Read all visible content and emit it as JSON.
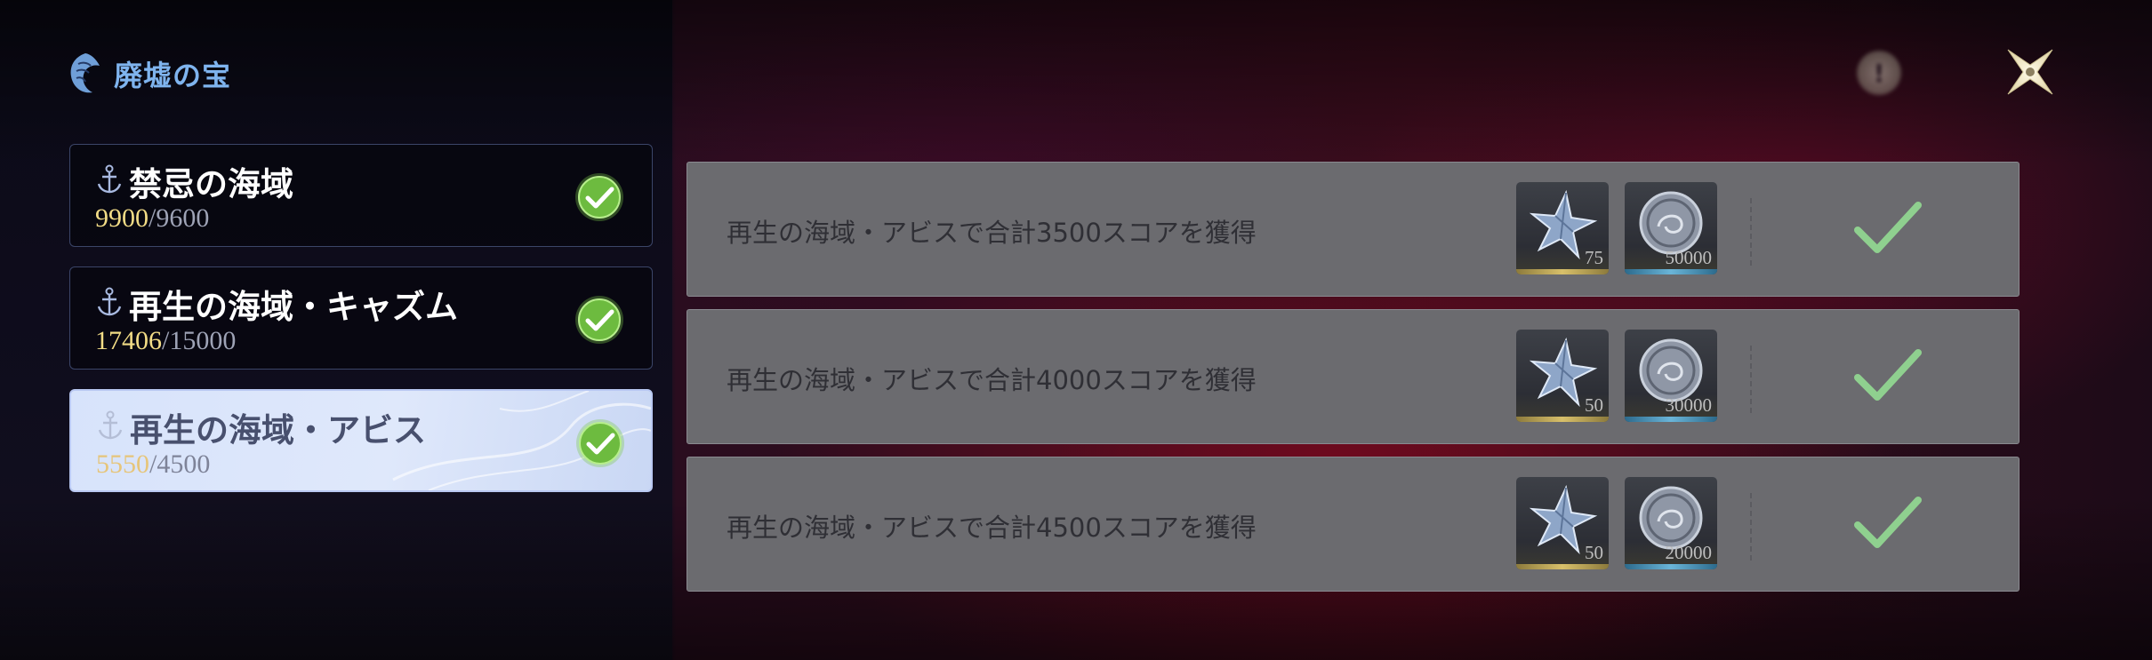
{
  "header": {
    "title": "廃墟の宝",
    "close_icon": "close-x-icon",
    "info_icon": "info-icon"
  },
  "sidebar": {
    "items": [
      {
        "name": "禁忌の海域",
        "current": "9900",
        "separator": "/",
        "max": "9600",
        "completed": true,
        "active": false
      },
      {
        "name": "再生の海域・キャズム",
        "current": "17406",
        "separator": "/",
        "max": "15000",
        "completed": true,
        "active": false
      },
      {
        "name": "再生の海域・アビス",
        "current": "5550",
        "separator": "/",
        "max": "4500",
        "completed": true,
        "active": true
      }
    ]
  },
  "tasks": [
    {
      "description": "再生の海域・アビスで合計3500スコアを獲得",
      "rewards": [
        {
          "icon": "star-shard-icon",
          "count": "75"
        },
        {
          "icon": "coin-icon",
          "count": "50000"
        }
      ],
      "claimed": true
    },
    {
      "description": "再生の海域・アビスで合計4000スコアを獲得",
      "rewards": [
        {
          "icon": "star-shard-icon",
          "count": "50"
        },
        {
          "icon": "coin-icon",
          "count": "30000"
        }
      ],
      "claimed": true
    },
    {
      "description": "再生の海域・アビスで合計4500スコアを獲得",
      "rewards": [
        {
          "icon": "star-shard-icon",
          "count": "50"
        },
        {
          "icon": "coin-icon",
          "count": "20000"
        }
      ],
      "claimed": true
    }
  ],
  "colors": {
    "accent_title": "#7fb4ee",
    "score_current": "#f2dc86",
    "check_green": "#7ac94b",
    "task_bg": "#6b6b6f"
  }
}
